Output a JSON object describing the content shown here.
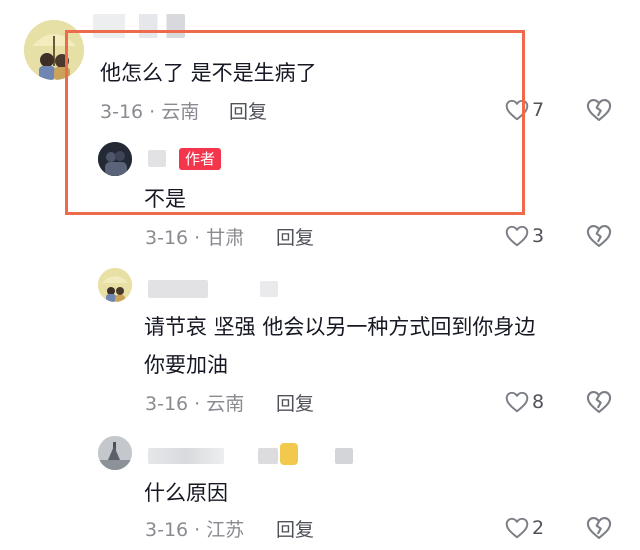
{
  "comments": [
    {
      "text": "他怎么了 是不是生病了",
      "meta": "3-16 · 云南",
      "reply_label": "回复",
      "likes": "7"
    },
    {
      "badge": "作者",
      "text": "不是",
      "meta": "3-16 · 甘肃",
      "reply_label": "回复",
      "likes": "3"
    },
    {
      "text_line1": "请节哀 坚强  他会以另一种方式回到你身边",
      "text_line2": "你要加油",
      "meta": "3-16 · 云南",
      "reply_label": "回复",
      "likes": "8"
    },
    {
      "text": "什么原因",
      "meta": "3-16 · 江苏",
      "reply_label": "回复",
      "likes": "2"
    }
  ],
  "colors": {
    "highlight_border": "#ee6a4c",
    "author_badge": "#f4364c",
    "meta_text": "#8a8b91"
  },
  "icons": {
    "like": "heart-outline-icon",
    "dislike": "broken-heart-icon"
  }
}
